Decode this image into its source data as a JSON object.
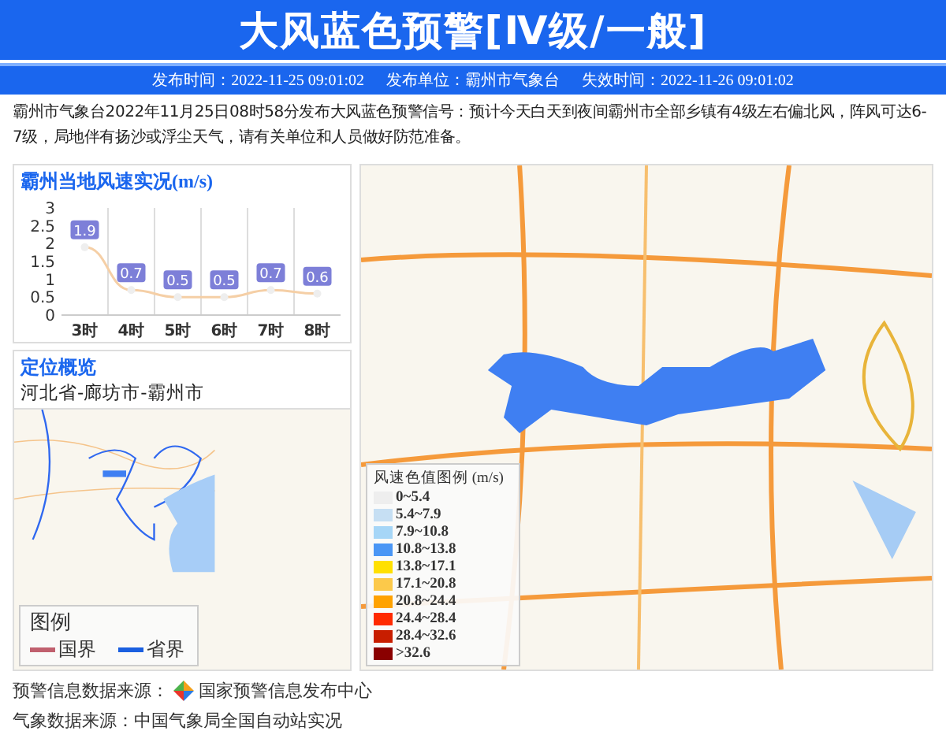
{
  "header": {
    "title": "大风蓝色预警[Ⅳ级/一般]"
  },
  "info_bar": [
    {
      "label": "发布时间：",
      "value": "2022-11-25 09:01:02"
    },
    {
      "label": "发布单位：",
      "value": "霸州市气象台"
    },
    {
      "label": "失效时间：",
      "value": "2022-11-26 09:01:02"
    }
  ],
  "description": "霸州市气象台2022年11月25日08时58分发布大风蓝色预警信号：预计今天白天到夜间霸州市全部乡镇有4级左右偏北风，阵风可达6-7级，局地伴有扬沙或浮尘天气，请有关单位和人员做好防范准备。",
  "wind_panel": {
    "title": "霸州当地风速实况",
    "unit": "(m/s)",
    "chart_data": {
      "type": "line",
      "categories": [
        "3时",
        "4时",
        "5时",
        "6时",
        "7时",
        "8时"
      ],
      "series": [
        {
          "color": "#f5cfa6",
          "marker": true,
          "values": [
            1.9,
            0.7,
            0.5,
            0.5,
            0.7,
            0.6
          ]
        }
      ],
      "value_labels": [
        "1.9",
        "0.7",
        "0.5",
        "0.5",
        "0.7",
        "0.6"
      ],
      "ylim": [
        0,
        3
      ],
      "yticks": [
        0,
        {
          "value": 0.5,
          "label": "0.5"
        },
        1,
        {
          "value": 1.5,
          "label": "1.5"
        },
        2,
        {
          "value": 2.5,
          "label": "2.5"
        },
        3
      ]
    }
  },
  "location_panel": {
    "title": "定位概览",
    "region": "河北省-廊坊市-霸州市",
    "legend": {
      "title": "图例",
      "items": [
        {
          "label": "国界",
          "color": "#c0606e"
        },
        {
          "label": "省界",
          "color": "#1a5fe0"
        }
      ]
    }
  },
  "detail_map": {
    "kind": "picture",
    "legend": {
      "title": "风速色值图例",
      "unit": "(m/s)",
      "items": [
        {
          "label": "0~5.4",
          "color": "#eeeeee"
        },
        {
          "label": "5.4~7.9",
          "color": "#c6dff3"
        },
        {
          "label": "7.9~10.8",
          "color": "#a6d6f7"
        },
        {
          "label": "10.8~13.8",
          "color": "#4a96f5"
        },
        {
          "label": "13.8~17.1",
          "color": "#ffe000"
        },
        {
          "label": "17.1~20.8",
          "color": "#fcc94a"
        },
        {
          "label": "20.8~24.4",
          "color": "#ffa200"
        },
        {
          "label": "24.4~28.4",
          "color": "#ff2a00"
        },
        {
          "label": "28.4~32.6",
          "color": "#c81e00"
        },
        {
          "label": ">32.6",
          "color": "#8a0000"
        }
      ]
    }
  },
  "sources": [
    {
      "label": "预警信息数据来源：",
      "value": "国家预警信息发布中心",
      "logo": true
    },
    {
      "label": "气象数据来源：",
      "value": "中国气象局全国自动站实况",
      "logo": false
    }
  ]
}
